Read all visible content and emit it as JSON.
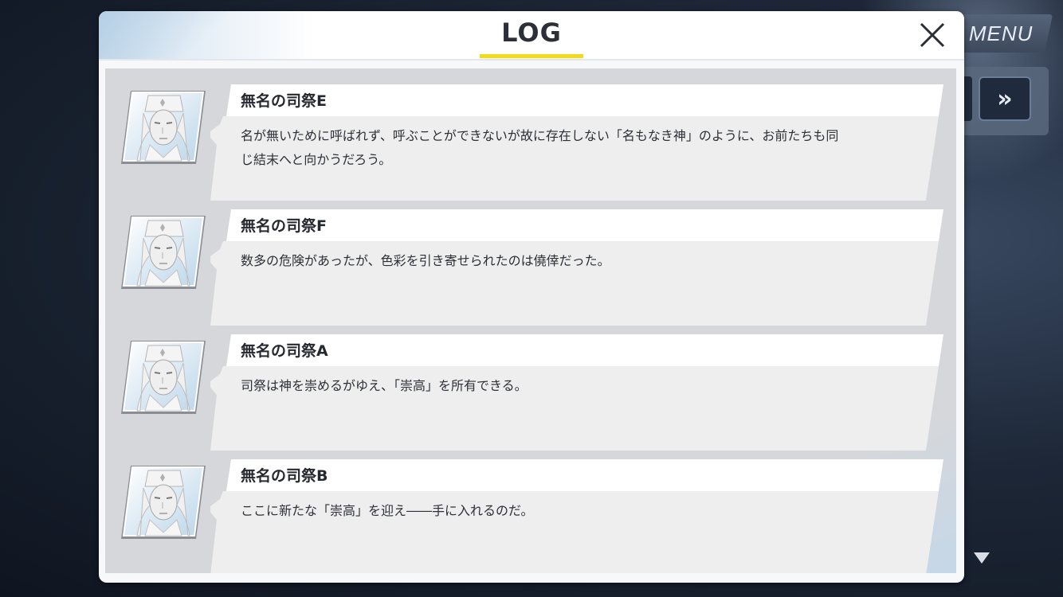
{
  "header": {
    "title": "LOG",
    "accent_color": "#f2dc1a"
  },
  "controls": {
    "menu_label": "MENU",
    "fast_forward_label": "»"
  },
  "entries": [
    {
      "speaker": "無名の司祭E",
      "text": "名が無いために呼ばれず、呼ぶことができないが故に存在しない「名もなき神」のように、お前たちも同じ結末へと向かうだろう。",
      "avatar": "masked-priest-icon"
    },
    {
      "speaker": "無名の司祭F",
      "text": "数多の危険があったが、色彩を引き寄せられたのは僥倖だった。",
      "avatar": "masked-priest-icon"
    },
    {
      "speaker": "無名の司祭A",
      "text": "司祭は神を崇めるがゆえ、「崇高」を所有できる。",
      "avatar": "masked-priest-icon"
    },
    {
      "speaker": "無名の司祭B",
      "text": "ここに新たな「崇高」を迎え――手に入れるのだ。",
      "avatar": "masked-priest-icon"
    }
  ]
}
